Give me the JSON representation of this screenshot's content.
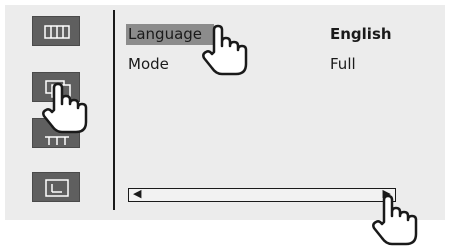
{
  "settings": {
    "rows": [
      {
        "label": "Language",
        "value": "English",
        "selected": true
      },
      {
        "label": "Mode",
        "value": "Full",
        "selected": false
      }
    ]
  },
  "side_icons": [
    "audio-settings-icon",
    "display-settings-icon",
    "adjustment-icon",
    "system-icon"
  ],
  "scrollbar": {
    "left_arrow": "◀",
    "right_arrow": "▶"
  },
  "colors": {
    "panel": "#ececec",
    "icon_button": "#5f5f5f",
    "highlight": "#8c8c8c"
  }
}
